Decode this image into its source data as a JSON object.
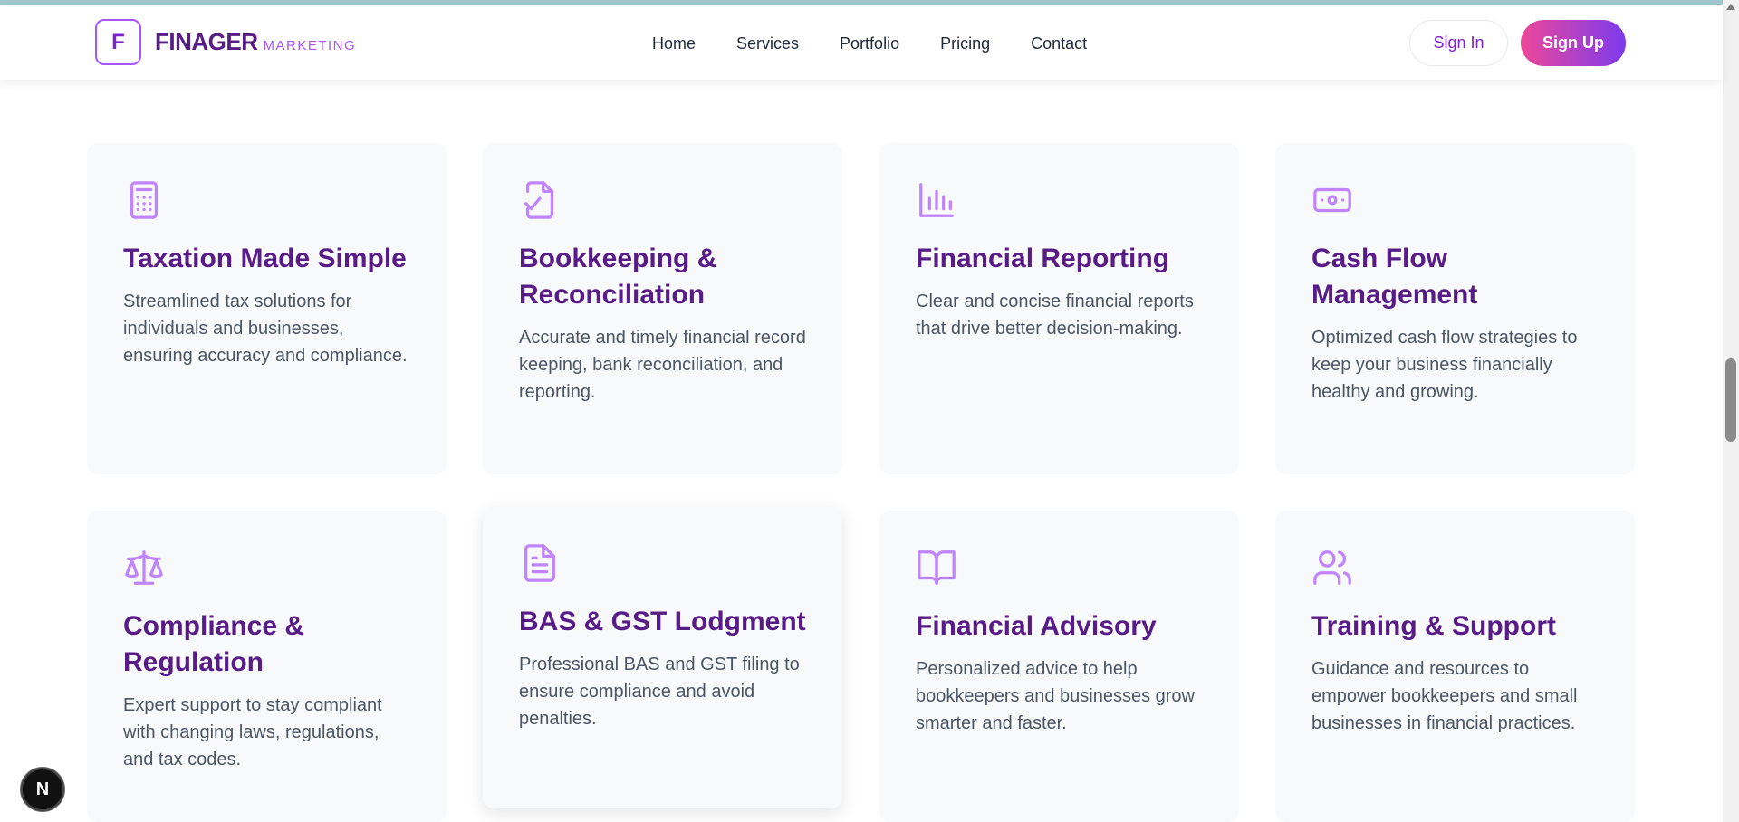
{
  "header": {
    "logo_letter": "F",
    "brand_name": "FINAGER",
    "brand_sub": "MARKETING",
    "nav": [
      "Home",
      "Services",
      "Portfolio",
      "Pricing",
      "Contact"
    ],
    "sign_in": "Sign In",
    "sign_up": "Sign Up"
  },
  "services": [
    {
      "icon": "calculator-icon",
      "title": "Taxation Made Simple",
      "description": "Streamlined tax solutions for individuals and businesses, ensuring accuracy and compliance."
    },
    {
      "icon": "file-check-icon",
      "title": "Bookkeeping & Reconciliation",
      "description": "Accurate and timely financial record keeping, bank reconciliation, and reporting."
    },
    {
      "icon": "bar-chart-icon",
      "title": "Financial Reporting",
      "description": "Clear and concise financial reports that drive better decision-making."
    },
    {
      "icon": "banknote-icon",
      "title": "Cash Flow Management",
      "description": "Optimized cash flow strategies to keep your business financially healthy and growing."
    },
    {
      "icon": "scale-icon",
      "title": "Compliance & Regulation",
      "description": "Expert support to stay compliant with changing laws, regulations, and tax codes."
    },
    {
      "icon": "file-text-icon",
      "title": "BAS & GST Lodgment",
      "description": "Professional BAS and GST filing to ensure compliance and avoid penalties."
    },
    {
      "icon": "book-open-icon",
      "title": "Financial Advisory",
      "description": "Personalized advice to help bookkeepers and businesses grow smarter and faster."
    },
    {
      "icon": "users-icon",
      "title": "Training & Support",
      "description": "Guidance and resources to empower bookkeepers and small businesses in financial practices."
    }
  ],
  "colors": {
    "brand_dark": "#581c87",
    "accent": "#a855f7",
    "icon": "#c084fc",
    "gradient_start": "#ec4899",
    "gradient_end": "#7c3aed"
  },
  "badge": {
    "letter": "N"
  }
}
